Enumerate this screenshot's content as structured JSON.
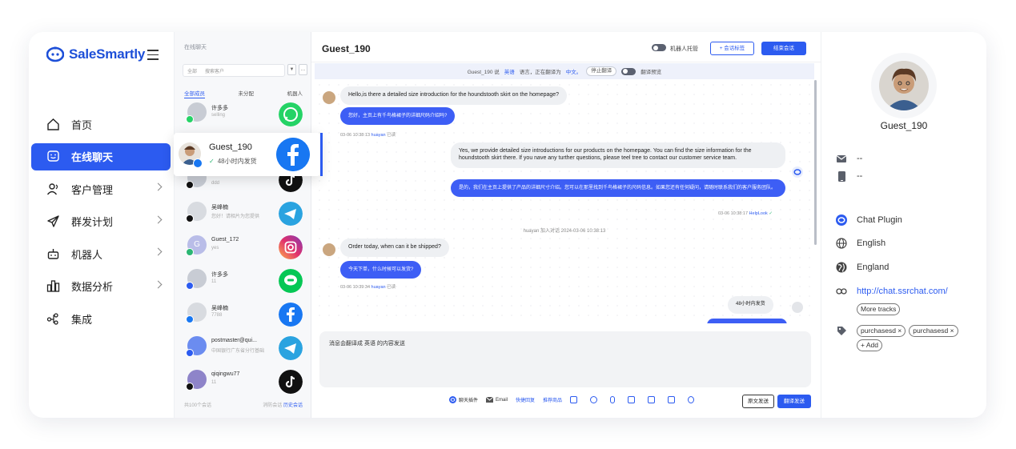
{
  "brand": {
    "name": "SaleSmartly",
    "color": "#1d4fd8"
  },
  "sidebar": {
    "items": [
      {
        "label": "首页",
        "icon": "home-icon"
      },
      {
        "label": "在线聊天",
        "icon": "chat-icon",
        "active": true
      },
      {
        "label": "客户管理",
        "icon": "users-icon"
      },
      {
        "label": "群发计划",
        "icon": "send-icon"
      },
      {
        "label": "机器人",
        "icon": "robot-icon"
      },
      {
        "label": "数据分析",
        "icon": "chart-icon"
      },
      {
        "label": "集成",
        "icon": "integration-icon"
      }
    ]
  },
  "convlist": {
    "title": "在线聊天",
    "search_scope": "全部",
    "search_placeholder": "搜索客户",
    "tabs": [
      "全部成员",
      "未分配",
      "机器人"
    ],
    "items": [
      {
        "name": "许多多",
        "preview": "selling",
        "channel": "whatsapp"
      },
      {
        "name": "Guest_190",
        "preview": "48小时内发货",
        "channel": "facebook"
      },
      {
        "name": "",
        "preview": "ddd",
        "channel": "tiktok"
      },
      {
        "name": "吴峰楠",
        "preview": "您好！请相片为您提供",
        "channel": "telegram"
      },
      {
        "name": "Guest_172",
        "preview": "yes",
        "channel": "instagram"
      },
      {
        "name": "许多多",
        "preview": "11",
        "channel": "line"
      },
      {
        "name": "吴峰楠",
        "preview": "7788",
        "channel": "facebook"
      },
      {
        "name": "postmaster@qui...",
        "preview": "中国银行广东省分行基础",
        "channel": "telegram"
      },
      {
        "name": "qiqingwu77",
        "preview": "11",
        "channel": "tiktok"
      }
    ],
    "footer_left": "共100个会话",
    "footer_mid": "消防会话",
    "footer_link": "历史会话"
  },
  "active_conv": {
    "name": "Guest_190",
    "preview": "48小时内发货"
  },
  "chat": {
    "title": "Guest_190",
    "robot_label": "机器人托管",
    "tag_button": "+ 会话标签",
    "end_button": "结束会话",
    "translate_bar": {
      "prefix": "Guest_190 说",
      "lang_src": "英语",
      "mid": "语言，正在翻译为",
      "lang_dst": "中文。",
      "stop": "停止翻译",
      "preview": "翻译预览"
    },
    "messages": [
      {
        "dir": "in",
        "text": "Hello,is there a detailed size introduction for the houndstooth skirt on the homepage?",
        "translation": "您好，主页上有千鸟格裙子的详细尺码介绍吗?",
        "meta_time": "03-06 10:38:13",
        "meta_user": "huayan",
        "meta_status": "已读"
      },
      {
        "dir": "out",
        "text": "Yes, we provide detailed size introductions for our products on the homepage. You can find the size information for the houndstooth skirt there. If you nave any turther questions, please teel tree to contact our customer service team.",
        "translation": "是的，我们在主页上提供了产品的详细尺寸介绍。您可以在那里找到千鸟格裙子的尺码信息。如果您还有任何疑问，请随时联系我们的客户服务团队。",
        "meta_time": "03-06 10:38:17",
        "meta_user": "HelpLook"
      },
      {
        "dir": "sys",
        "text": "huayan  加入对话  2024-03-06 10:38:13"
      },
      {
        "dir": "in",
        "text": "Order today, when can it be shipped?",
        "translation": "今天下单，什么时候可以发货?",
        "meta_time": "03-06 10:39:34",
        "meta_user": "huayan",
        "meta_status": "已读"
      },
      {
        "dir": "out",
        "text": "48小时内发货"
      }
    ],
    "composer_text": "消息会翻译成 英语 的内容发送",
    "tools": [
      "聊天插件",
      "Email",
      "快捷回复",
      "推荐商品"
    ],
    "send_original": "原文发送",
    "send_translated": "翻译发送"
  },
  "profile": {
    "name": "Guest_190",
    "email": "--",
    "phone": "--",
    "channel": "Chat Plugin",
    "language": "English",
    "country": "England",
    "url": "http://chat.ssrchat.com/",
    "more_tracks": "More tracks",
    "tags": [
      "purchasesd ×",
      "purchasesd ×"
    ],
    "add_tag": "+ Add"
  },
  "colors": {
    "accent": "#2c5bf0",
    "bubble_translated": "#3d5ef5"
  }
}
